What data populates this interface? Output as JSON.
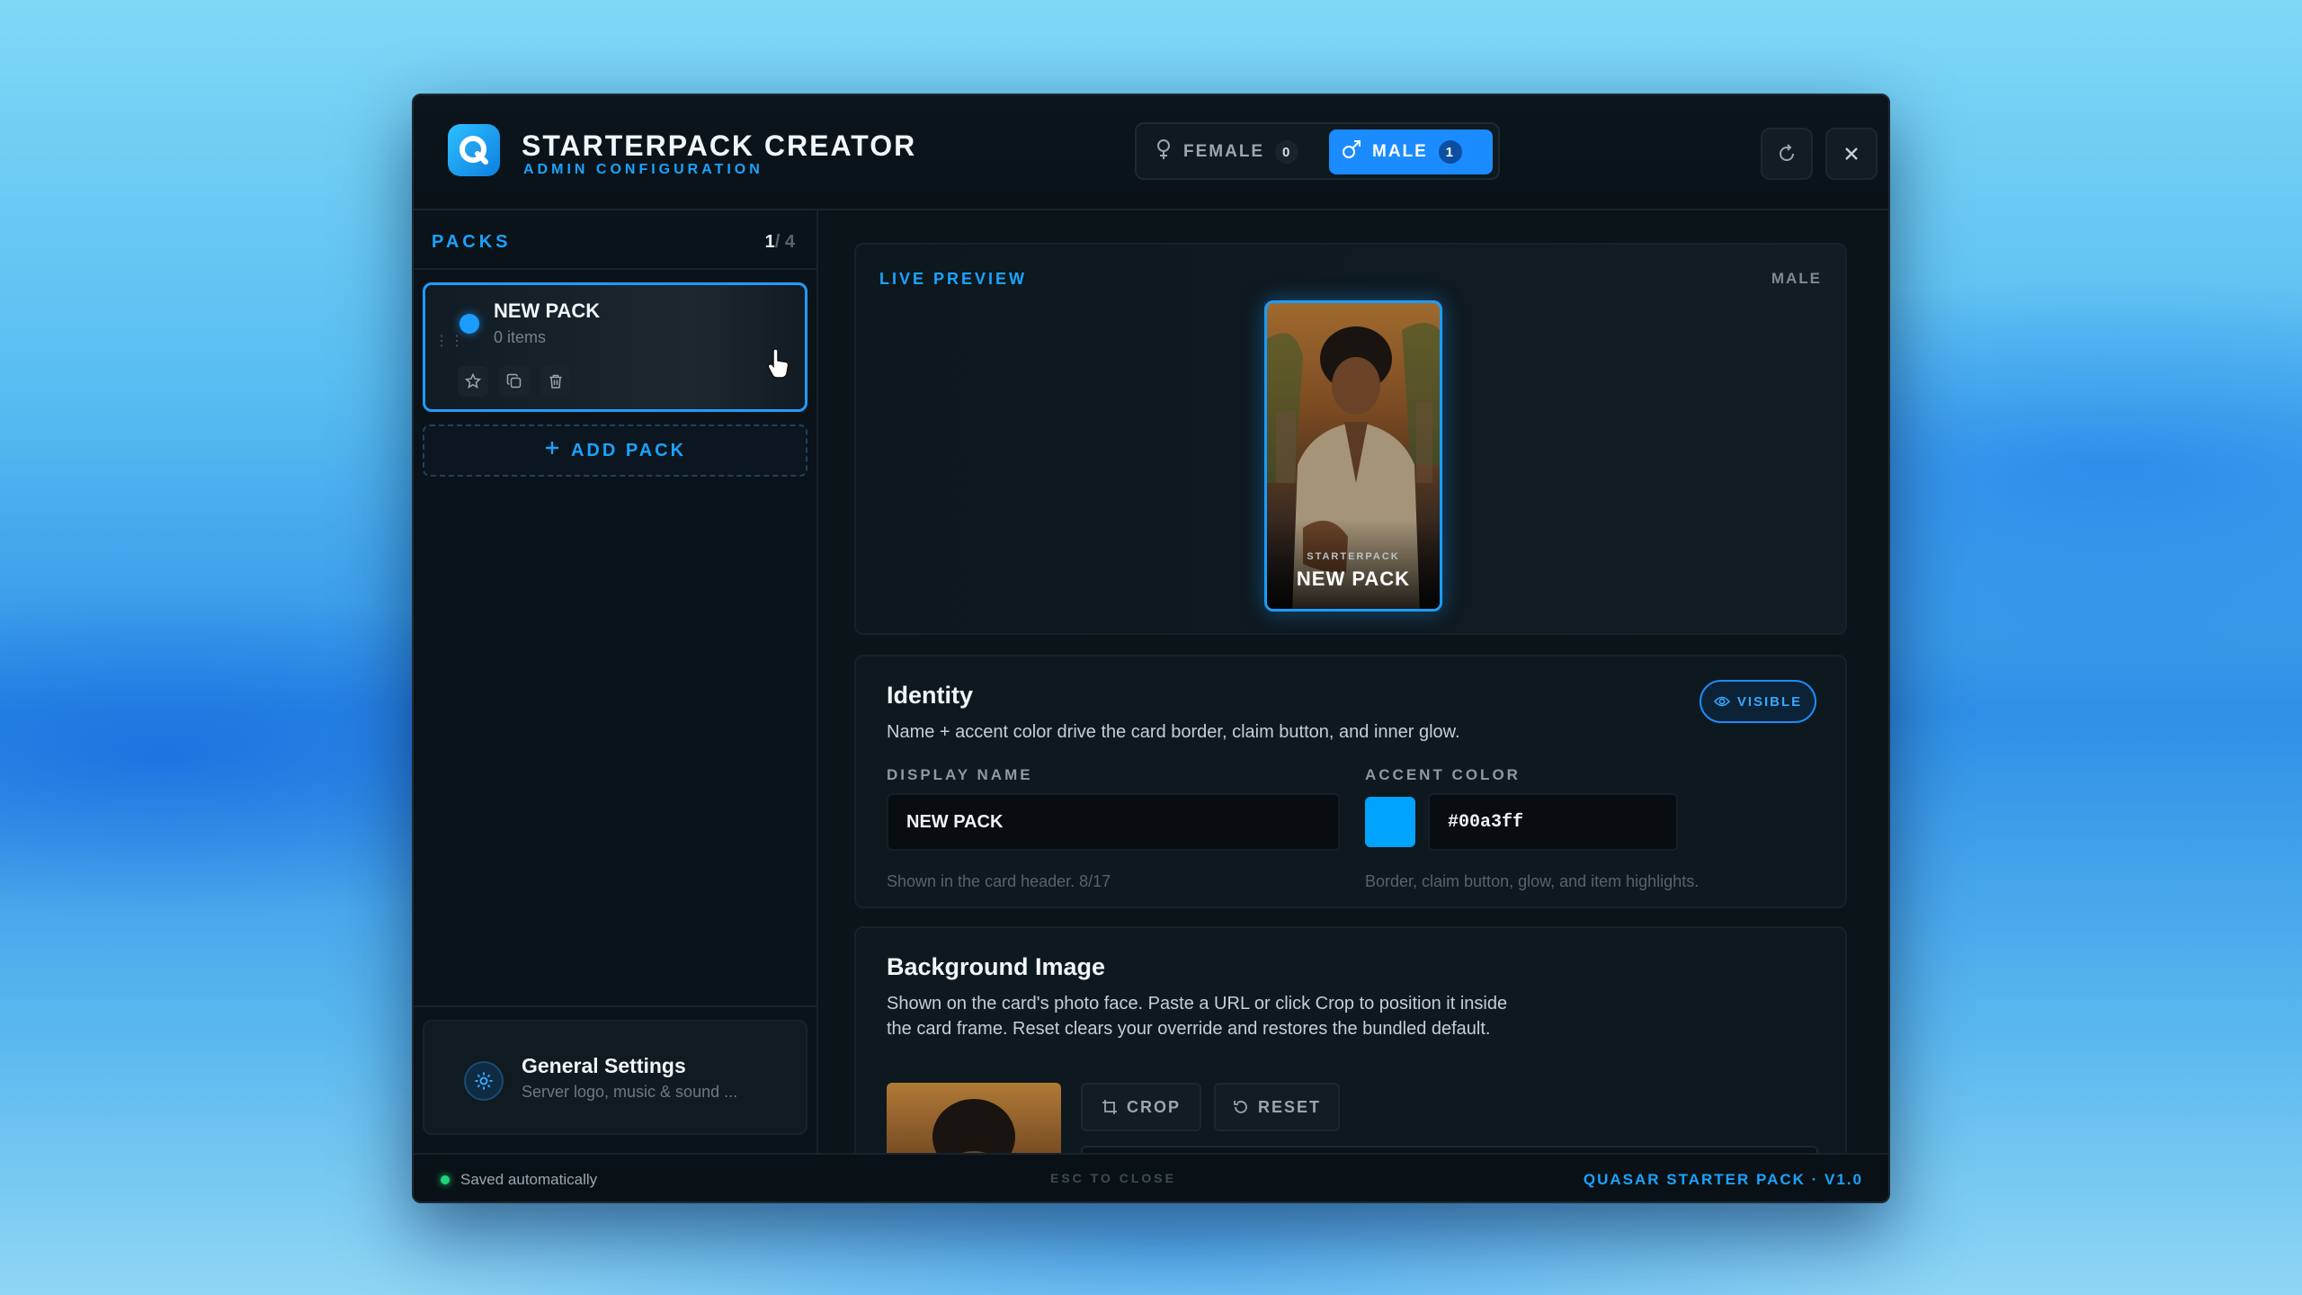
{
  "header": {
    "title": "STARTERPACK CREATOR",
    "subtitle": "ADMIN CONFIGURATION",
    "gender_toggle": {
      "female_label": "FEMALE",
      "female_count": "0",
      "male_label": "MALE",
      "male_count": "1",
      "selected": "male"
    }
  },
  "sidebar": {
    "packs_label": "PACKS",
    "packs_current": "1",
    "packs_total": "/ 4",
    "packs": [
      {
        "name": "NEW PACK",
        "items": "0 items",
        "accent": "#00a3ff"
      }
    ],
    "add_pack_label": "ADD PACK",
    "general_settings": {
      "title": "General Settings",
      "subtitle": "Server logo, music & sound ..."
    }
  },
  "preview": {
    "label": "LIVE PREVIEW",
    "gender": "MALE",
    "card_kicker": "STARTERPACK",
    "card_name": "NEW PACK"
  },
  "identity": {
    "title": "Identity",
    "description": "Name + accent color drive the card border, claim button, and inner glow.",
    "visible_label": "VISIBLE",
    "display_name_label": "DISPLAY NAME",
    "display_name_value": "NEW PACK",
    "display_name_hint": "Shown in the card header. 8/17",
    "accent_label": "ACCENT COLOR",
    "accent_value": "#00a3ff",
    "accent_hint": "Border, claim button, glow, and item highlights."
  },
  "background_image": {
    "title": "Background Image",
    "description": "Shown on the card's photo face. Paste a URL or click Crop to position it inside the card frame. Reset clears your override and restores the bundled default.",
    "crop_label": "CROP",
    "reset_label": "RESET"
  },
  "footer": {
    "status": "Saved automatically",
    "esc_hint": "ESC TO CLOSE",
    "version": "QUASAR STARTER PACK · V1.0"
  },
  "colors": {
    "accent": "#1a9dff",
    "background": "#0a1218",
    "saved_indicator": "#1dd67a"
  }
}
